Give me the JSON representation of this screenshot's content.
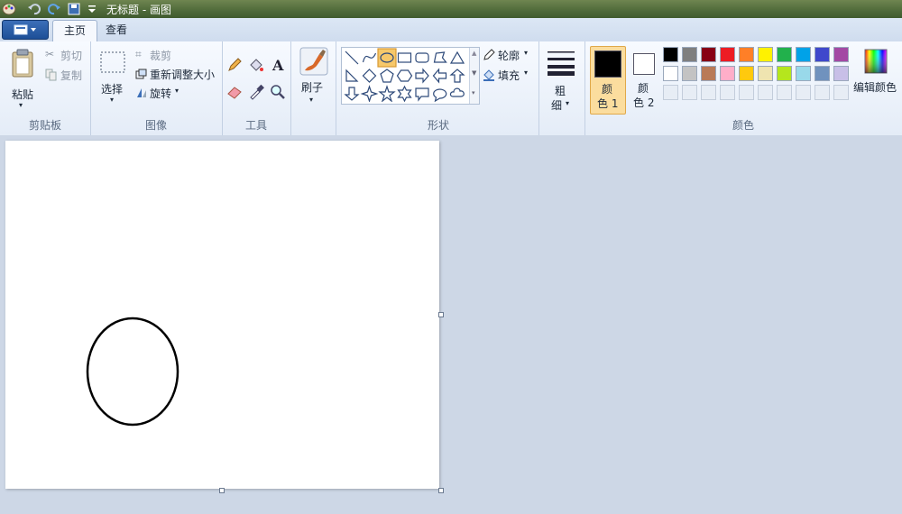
{
  "window": {
    "title": "无标题 - 画图"
  },
  "tabs": [
    {
      "label": "主页",
      "active": true
    },
    {
      "label": "查看",
      "active": false
    }
  ],
  "clipboard": {
    "paste": "粘贴",
    "cut": "剪切",
    "copy": "复制",
    "group": "剪贴板"
  },
  "image": {
    "select": "选择",
    "crop": "裁剪",
    "resize": "重新调整大小",
    "rotate": "旋转",
    "group": "图像"
  },
  "tools": {
    "group": "工具"
  },
  "brushes": {
    "label": "刷子"
  },
  "shapes": {
    "outline": "轮廓",
    "fill": "填充",
    "group": "形状"
  },
  "size": {
    "label_line1": "粗",
    "label_line2": "细"
  },
  "colors": {
    "color1_line1": "颜",
    "color1_line2": "色 1",
    "color2_line1": "颜",
    "color2_line2": "色 2",
    "edit": "编辑颜色",
    "group": "颜色",
    "color1": "#000000",
    "color2": "#ffffff",
    "palette_row1": [
      "#000000",
      "#7f7f7f",
      "#880015",
      "#ed1c24",
      "#ff7f27",
      "#fff200",
      "#22b14c",
      "#00a2e8",
      "#3f48cc",
      "#a349a4"
    ],
    "palette_row2": [
      "#ffffff",
      "#c3c3c3",
      "#b97a57",
      "#ffaec9",
      "#ffc90e",
      "#efe4b0",
      "#b5e61d",
      "#99d9ea",
      "#7092be",
      "#c8bfe7"
    ]
  },
  "accent": "#f7c86a"
}
